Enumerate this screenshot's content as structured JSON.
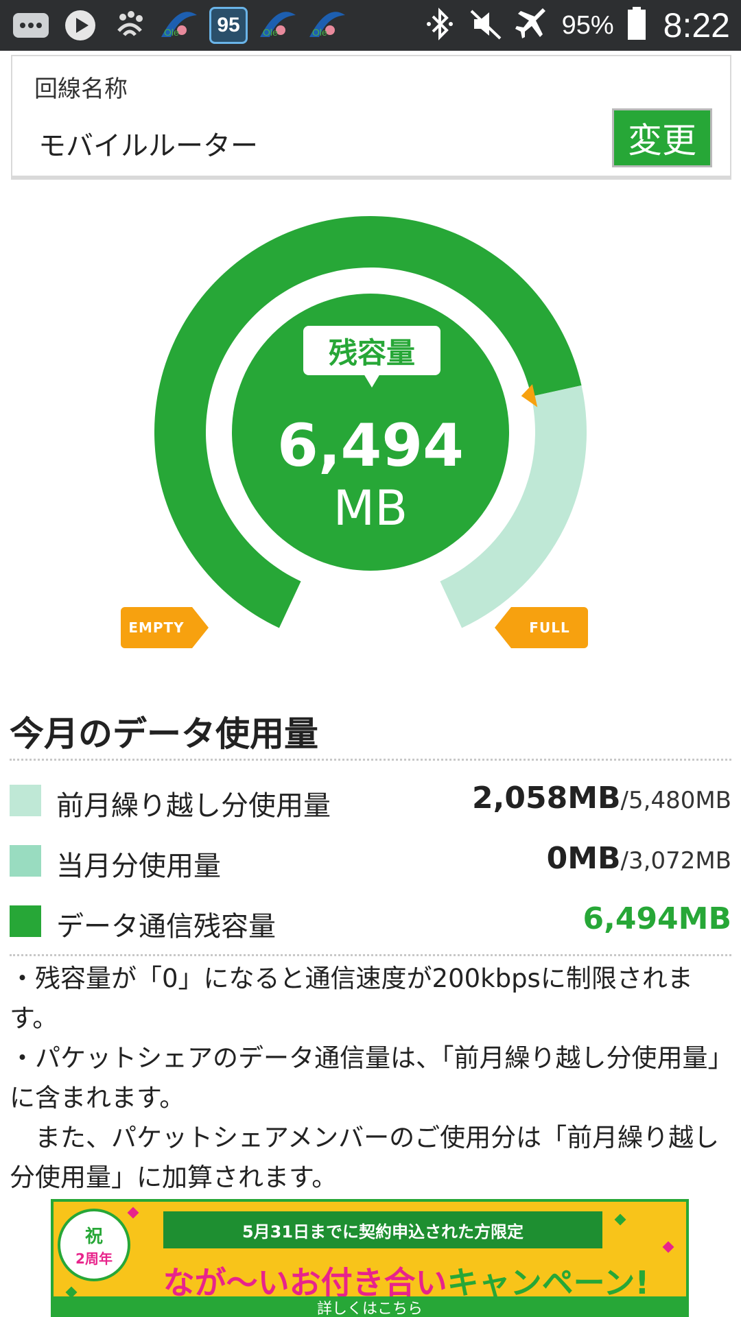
{
  "status_bar": {
    "badge": "95",
    "battery": "95%",
    "time": "8:22",
    "icons": [
      "messages-icon",
      "play-icon",
      "paw-wifi-icon",
      "ole-app-icon",
      "badge-95-icon",
      "ole-app-icon",
      "ole-app-icon",
      "bluetooth-icon",
      "mute-icon",
      "airplane-icon",
      "battery-icon"
    ]
  },
  "line": {
    "label": "回線名称",
    "value": "モバイルルーター",
    "change_label": "変更"
  },
  "gauge": {
    "bubble_label": "残容量",
    "remaining_value": "6,494",
    "remaining_unit": "MB",
    "empty_label": "EMPTY",
    "full_label": "FULL",
    "remaining_fraction": 0.75,
    "colors": {
      "dark": "#27a737",
      "light": "#bfe8d6",
      "marker": "#f7a10f"
    }
  },
  "usage": {
    "title": "今月のデータ使用量",
    "rows": [
      {
        "label": "前月繰り越し分使用量",
        "value": "2,058MB",
        "total": "/5,480MB",
        "color": "#bfe8d6"
      },
      {
        "label": "当月分使用量",
        "value": "0MB",
        "total": "/3,072MB",
        "color": "#99dcc0"
      },
      {
        "label": "データ通信残容量",
        "value": "6,494MB",
        "total": "",
        "color": "#27a737"
      }
    ]
  },
  "notes": [
    "・残容量が「0」になると通信速度が200kbpsに制限されます。",
    "・パケットシェアのデータ通信量は、「前月繰り越し分使用量」に含まれます。",
    "　また、パケットシェアメンバーのご使用分は「前月繰り越し分使用量」に加算されます。"
  ],
  "banner": {
    "seal_top": "祝",
    "seal_bottom": "2周年",
    "ribbon": "5月31日までに契約申込された方限定",
    "title_pink": "なが〜いお付き合い",
    "title_green": "キャンペーン!",
    "sub": "詳しくはこちら"
  }
}
